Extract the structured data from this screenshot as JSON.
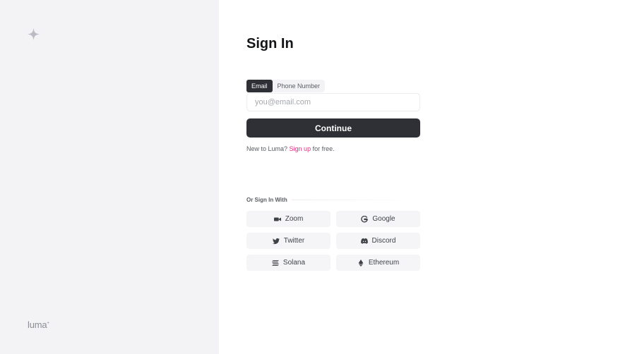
{
  "brand": {
    "name": "luma",
    "mark": "+"
  },
  "signin": {
    "title": "Sign In",
    "tabs": [
      {
        "label": "Email",
        "active": true
      },
      {
        "label": "Phone Number",
        "active": false
      }
    ],
    "email": {
      "value": "",
      "placeholder": "you@email.com"
    },
    "continue_label": "Continue",
    "signup": {
      "prefix": "New to Luma?",
      "link": "Sign up",
      "suffix": "for free."
    }
  },
  "social": {
    "label": "Or Sign In With",
    "providers": [
      {
        "label": "Zoom",
        "icon": "video-camera-icon"
      },
      {
        "label": "Google",
        "icon": "google-icon"
      },
      {
        "label": "Twitter",
        "icon": "twitter-icon"
      },
      {
        "label": "Discord",
        "icon": "discord-icon"
      },
      {
        "label": "Solana",
        "icon": "solana-icon"
      },
      {
        "label": "Ethereum",
        "icon": "ethereum-icon"
      }
    ]
  },
  "colors": {
    "accent": "#e0307a",
    "primary_button": "#2e3036",
    "sidebar_bg": "#f3f3f6"
  }
}
